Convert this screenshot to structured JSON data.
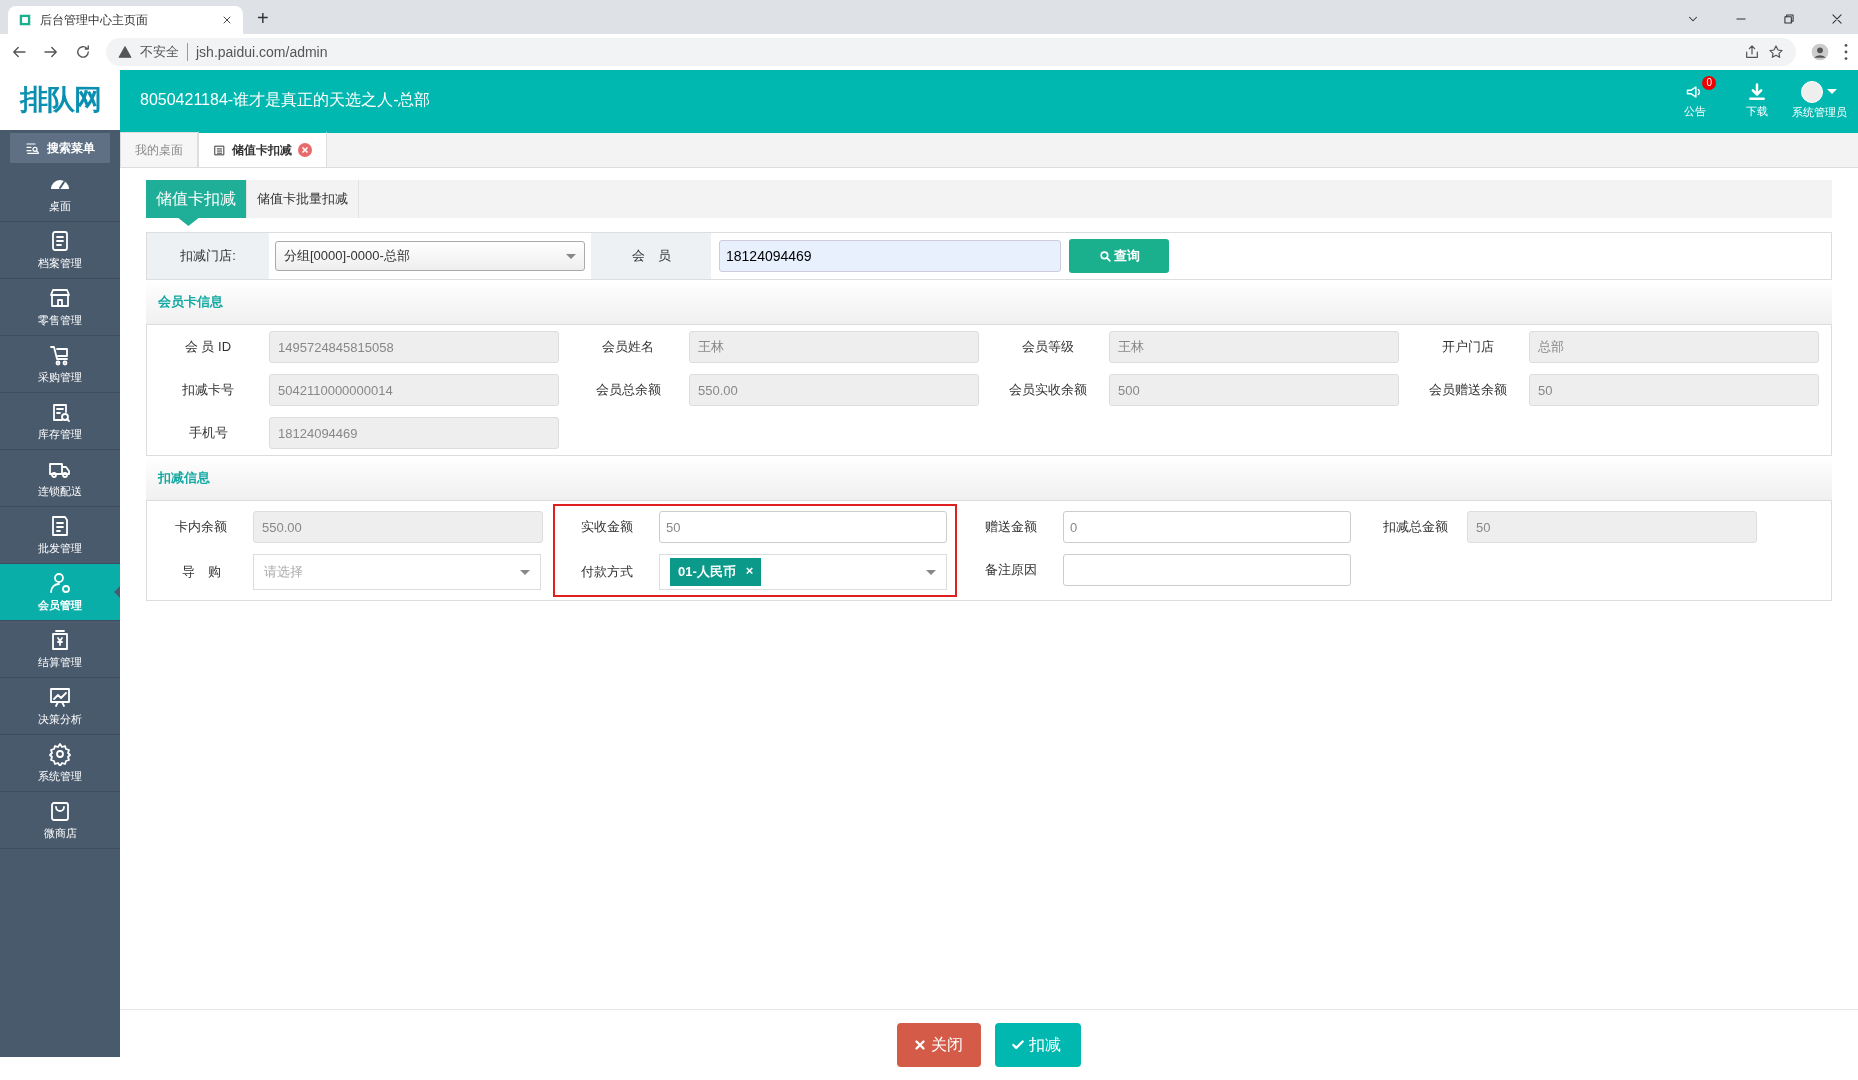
{
  "browser": {
    "tab_title": "后台管理中心主页面",
    "new_tab": "+",
    "security": "不安全",
    "url": "jsh.paidui.com/admin"
  },
  "header": {
    "logo": "排队网",
    "title": "8050421184-谁才是真正的天选之人-总部",
    "actions": [
      {
        "label": "公告",
        "badge": "0"
      },
      {
        "label": "下载"
      },
      {
        "label": "系统管理员"
      }
    ]
  },
  "sidebar": {
    "search": "搜索菜单",
    "items": [
      {
        "label": "桌面",
        "selected": false
      },
      {
        "label": "档案管理",
        "selected": false
      },
      {
        "label": "零售管理",
        "selected": false
      },
      {
        "label": "采购管理",
        "selected": false
      },
      {
        "label": "库存管理",
        "selected": false
      },
      {
        "label": "连锁配送",
        "selected": false
      },
      {
        "label": "批发管理",
        "selected": false
      },
      {
        "label": "会员管理",
        "selected": true
      },
      {
        "label": "结算管理",
        "selected": false
      },
      {
        "label": "决策分析",
        "selected": false
      },
      {
        "label": "系统管理",
        "selected": false
      },
      {
        "label": "微商店",
        "selected": false
      }
    ]
  },
  "page_tabs": [
    {
      "label": "我的桌面",
      "selected": false,
      "closable": false
    },
    {
      "label": "储值卡扣减",
      "selected": true,
      "closable": true
    }
  ],
  "sub_tabs": [
    {
      "label": "储值卡扣减",
      "selected": true
    },
    {
      "label": "储值卡批量扣减",
      "selected": false
    }
  ],
  "query": {
    "store_label": "扣减门店:",
    "store_value": "分组[0000]-0000-总部",
    "member_label": "会　员",
    "member_value": "18124094469",
    "button": "查询"
  },
  "card_info": {
    "title": "会员卡信息",
    "fields": [
      {
        "label": "会 员 ID",
        "value": "1495724845815058"
      },
      {
        "label": "会员姓名",
        "value": "王林"
      },
      {
        "label": "会员等级",
        "value": "王林"
      },
      {
        "label": "开户门店",
        "value": "总部"
      },
      {
        "label": "扣减卡号",
        "value": "5042110000000014"
      },
      {
        "label": "会员总余额",
        "value": "550.00"
      },
      {
        "label": "会员实收余额",
        "value": "500"
      },
      {
        "label": "会员赠送余额",
        "value": "50"
      },
      {
        "label": "手机号",
        "value": "18124094469"
      }
    ]
  },
  "deduction": {
    "title": "扣减信息",
    "columns": [
      {
        "highlighted": false,
        "fields": [
          {
            "kind": "readonly",
            "label": "卡内余额",
            "value": "550.00"
          },
          {
            "kind": "select",
            "label": "导　购",
            "placeholder": "请选择"
          }
        ]
      },
      {
        "highlighted": true,
        "fields": [
          {
            "kind": "input",
            "label": "实收金额",
            "value": "50"
          },
          {
            "kind": "tag_select",
            "label": "付款方式",
            "tag": "01-人民币",
            "remove": "×"
          }
        ]
      },
      {
        "highlighted": false,
        "fields": [
          {
            "kind": "input",
            "label": "赠送金额",
            "value": "0"
          },
          {
            "kind": "input",
            "label": "备注原因"
          }
        ]
      },
      {
        "highlighted": false,
        "fields": [
          {
            "kind": "readonly",
            "label": "扣减总金额",
            "value": "50"
          }
        ]
      }
    ]
  },
  "footer": {
    "buttons": [
      {
        "kind": "close",
        "label": "关闭"
      },
      {
        "kind": "confirm",
        "label": "扣减"
      }
    ]
  }
}
